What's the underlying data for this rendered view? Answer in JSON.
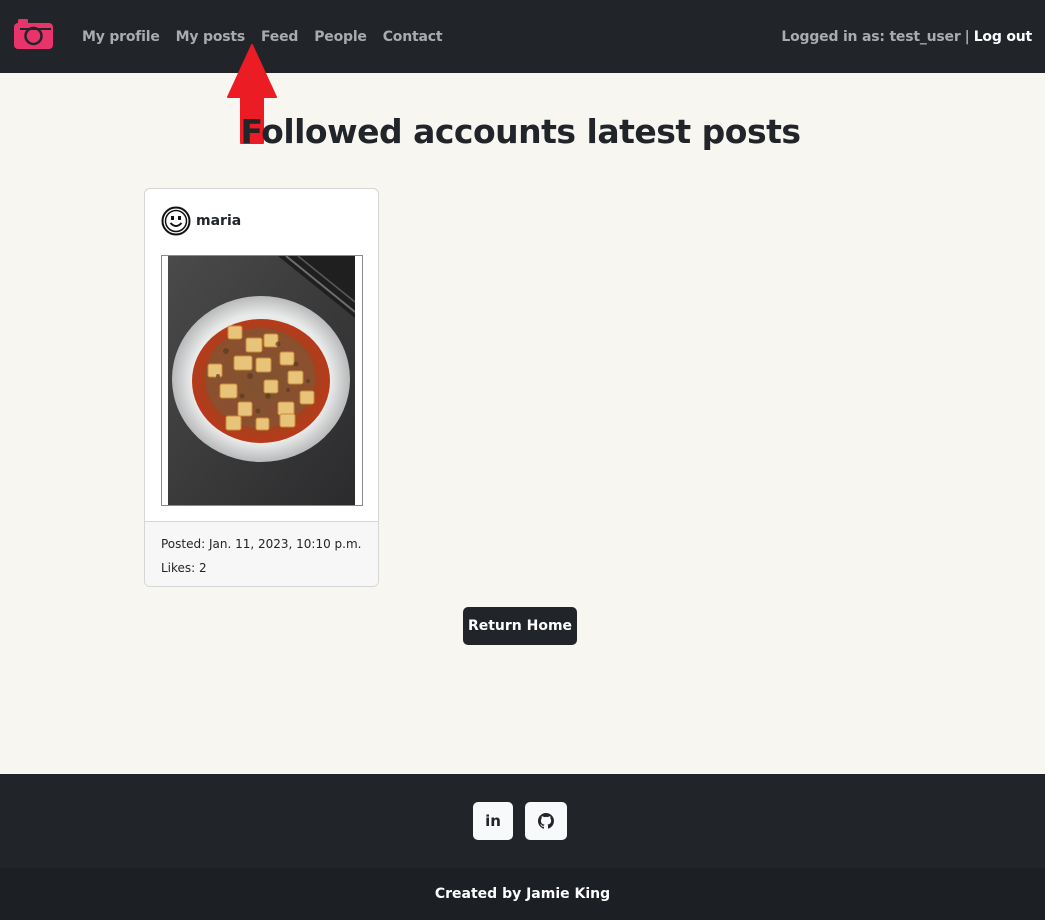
{
  "navbar": {
    "links": [
      {
        "label": "My profile"
      },
      {
        "label": "My posts"
      },
      {
        "label": "Feed"
      },
      {
        "label": "People"
      },
      {
        "label": "Contact"
      }
    ],
    "logged_in_text": "Logged in as: test_user",
    "separator": "|",
    "logout_label": "Log out",
    "brand_icon": "camera-icon",
    "brand_color": "#e8336b"
  },
  "annotation": {
    "arrow_color": "#ec1c24",
    "points_to": "Feed"
  },
  "main": {
    "title": "Followed accounts latest posts",
    "posts": [
      {
        "author": "maria",
        "avatar_icon": "smiley-face-icon",
        "image_alt": "mapo tofu in a bowl",
        "posted": "Posted: Jan. 11, 2023, 10:10 p.m.",
        "likes": "Likes: 2"
      }
    ],
    "return_button": "Return Home"
  },
  "footer": {
    "social": [
      {
        "icon": "linkedin-icon",
        "label": "in"
      },
      {
        "icon": "github-icon"
      }
    ],
    "credit": "Created by Jamie King"
  }
}
